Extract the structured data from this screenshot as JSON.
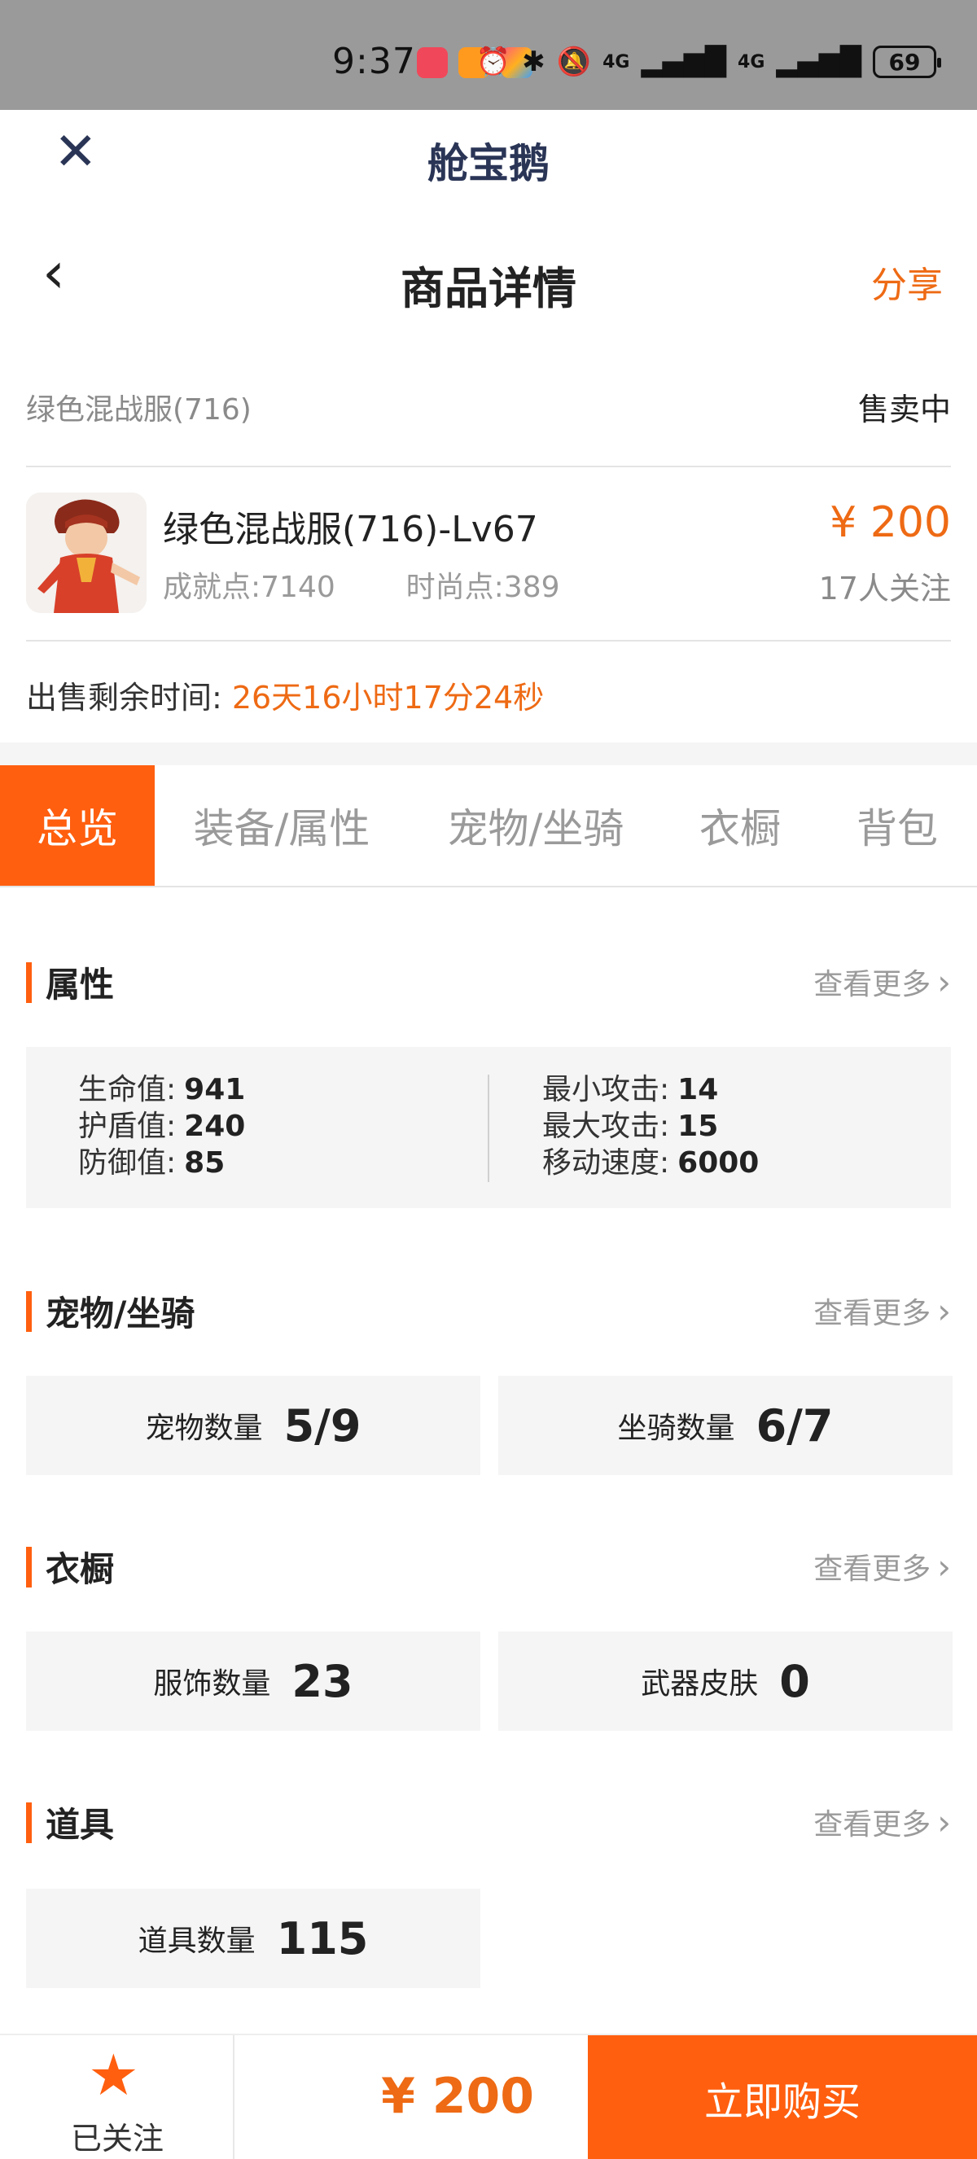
{
  "status_bar": {
    "time": "9:37",
    "battery": "69",
    "signal1": "4G",
    "signal2": "4G",
    "icons": [
      "alarm-icon",
      "bluetooth-icon",
      "vibrate-icon",
      "mute-icon",
      "signal-icon",
      "signal-icon",
      "battery-icon"
    ]
  },
  "mini_program": {
    "title": "舱宝鹅",
    "close_icon": "close-icon"
  },
  "nav": {
    "title": "商品详情",
    "share_label": "分享",
    "back_icon": "back-icon"
  },
  "product": {
    "name_small": "绿色混战服(716)",
    "status": "售卖中",
    "title": "绿色混战服(716)-Lv67",
    "achievement": "成就点:7140",
    "fashion": "时尚点:389",
    "price": "¥ 200",
    "followers": "17人关注",
    "remain_label": "出售剩余时间:",
    "remain_value": "26天16小时17分24秒"
  },
  "tabs": [
    {
      "label": "总览",
      "active": true
    },
    {
      "label": "装备/属性",
      "active": false
    },
    {
      "label": "宠物/坐骑",
      "active": false
    },
    {
      "label": "衣橱",
      "active": false
    },
    {
      "label": "背包",
      "active": false
    }
  ],
  "more_label": "查看更多",
  "sections": {
    "attributes": {
      "title": "属性",
      "left": [
        {
          "k": "生命值:",
          "v": "941"
        },
        {
          "k": "护盾值:",
          "v": "240"
        },
        {
          "k": "防御值:",
          "v": "85"
        }
      ],
      "right": [
        {
          "k": "最小攻击:",
          "v": "14"
        },
        {
          "k": "最大攻击:",
          "v": "15"
        },
        {
          "k": "移动速度:",
          "v": "6000"
        }
      ]
    },
    "pets": {
      "title": "宠物/坐骑",
      "items": [
        {
          "k": "宠物数量",
          "v": "5/9"
        },
        {
          "k": "坐骑数量",
          "v": "6/7"
        }
      ]
    },
    "wardrobe": {
      "title": "衣橱",
      "items": [
        {
          "k": "服饰数量",
          "v": "23"
        },
        {
          "k": "武器皮肤",
          "v": "0"
        }
      ]
    },
    "props": {
      "title": "道具",
      "items": [
        {
          "k": "道具数量",
          "v": "115"
        }
      ]
    }
  },
  "bottom_bar": {
    "follow_label": "已关注",
    "price": "¥ 200",
    "buy_label": "立即购买"
  },
  "colors": {
    "accent": "#ff5f0f",
    "price": "#ee6a14",
    "header_text": "#2a3556"
  }
}
